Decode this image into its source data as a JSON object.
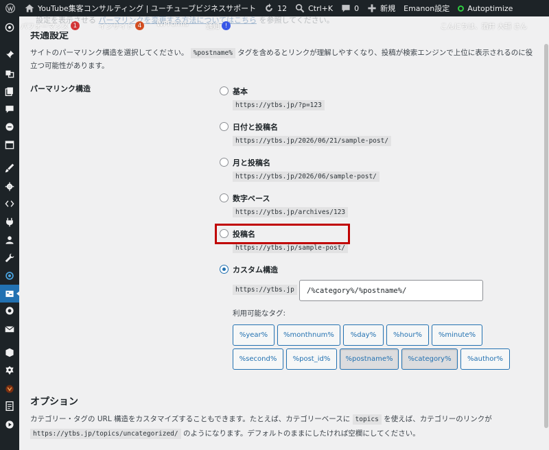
{
  "adminbar": {
    "site_title": "YouTube集客コンサルティング | ユーチューブビジネスサポート",
    "updates_count": "12",
    "shortcut": "Ctrl+K",
    "comments_count": "0",
    "new_label": "新規",
    "theme_settings": "Emanon設定",
    "autoptimize": "Autoptimize"
  },
  "subbar": {
    "faded_text_prefix": "設定を表示させる",
    "faded_link": "パーマリンクを変更する方法についてはこちら",
    "faded_text_suffix": "を参照してください。",
    "perf_label": "パフォーマンス",
    "perf_badge": "1",
    "insight_label": "インサイト",
    "insight_badge": "4",
    "wpforms_label": "WPForms",
    "notice_label": "通知",
    "notice_badge": "!",
    "greeting": "こんにちは、酒井 大輔 さん"
  },
  "common": {
    "heading": "共通設定",
    "description_pre": "サイトのパーマリンク構造を選択してください。",
    "description_code": "%postname%",
    "description_post": "タグを含めるとリンクが理解しやすくなり、投稿が検索エンジンで上位に表示されるのに役立つ可能性があります。",
    "field_label": "パーマリンク構造"
  },
  "options": [
    {
      "label": "基本",
      "example": "https://ytbs.jp/?p=123",
      "checked": false
    },
    {
      "label": "日付と投稿名",
      "example": "https://ytbs.jp/2026/06/21/sample-post/",
      "checked": false
    },
    {
      "label": "月と投稿名",
      "example": "https://ytbs.jp/2026/06/sample-post/",
      "checked": false
    },
    {
      "label": "数字ベース",
      "example": "https://ytbs.jp/archives/123",
      "checked": false
    },
    {
      "label": "投稿名",
      "example": "https://ytbs.jp/sample-post/",
      "checked": false
    },
    {
      "label": "カスタム構造",
      "checked": true
    }
  ],
  "custom": {
    "prefix": "https://ytbs.jp",
    "value": "/%category%/%postname%/",
    "tags_label": "利用可能なタグ:"
  },
  "tags": [
    {
      "label": "%year%",
      "active": false
    },
    {
      "label": "%monthnum%",
      "active": false
    },
    {
      "label": "%day%",
      "active": false
    },
    {
      "label": "%hour%",
      "active": false
    },
    {
      "label": "%minute%",
      "active": false
    },
    {
      "label": "%second%",
      "active": false
    },
    {
      "label": "%post_id%",
      "active": false
    },
    {
      "label": "%postname%",
      "active": true
    },
    {
      "label": "%category%",
      "active": true
    },
    {
      "label": "%author%",
      "active": false
    }
  ],
  "optional": {
    "heading": "オプション",
    "line1_pre": "カテゴリー・タグの URL 構造をカスタマイズすることもできます。たとえば、カテゴリーベースに",
    "line1_code": "topics",
    "line1_post": "を使えば、カテゴリーのリンクが",
    "line2_code": "https://ytbs.jp/topics/uncategorized/",
    "line2_post": "のようになります。デフォルトのままにしたければ空欄にしてください。"
  },
  "colors": {
    "adminbar_bg": "#1d2327",
    "accent": "#2271b1",
    "highlight": "#c00000"
  }
}
